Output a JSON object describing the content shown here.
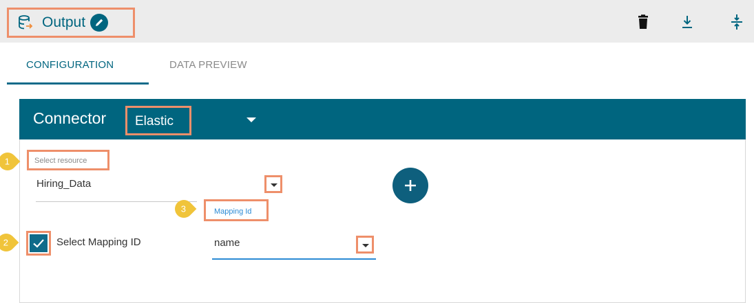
{
  "header": {
    "title": "Output",
    "icons": [
      "database-output-icon",
      "edit-icon",
      "trash-icon",
      "download-icon",
      "collapse-icon"
    ]
  },
  "tabs": [
    {
      "label": "CONFIGURATION",
      "active": true
    },
    {
      "label": "DATA PREVIEW",
      "active": false
    }
  ],
  "connector": {
    "label": "Connector",
    "value": "Elastic"
  },
  "form": {
    "resource_label": "Select resource",
    "resource_value": "Hiring_Data",
    "mapping_label": "Mapping Id",
    "mapping_checkbox_label": "Select Mapping ID",
    "mapping_checked": true,
    "mapping_value": "name"
  },
  "badges": [
    "1",
    "2",
    "3"
  ],
  "colors": {
    "accent": "#00657f",
    "highlight": "#ee8f6a",
    "badge": "#f0c43a",
    "link": "#2a8ad4"
  }
}
